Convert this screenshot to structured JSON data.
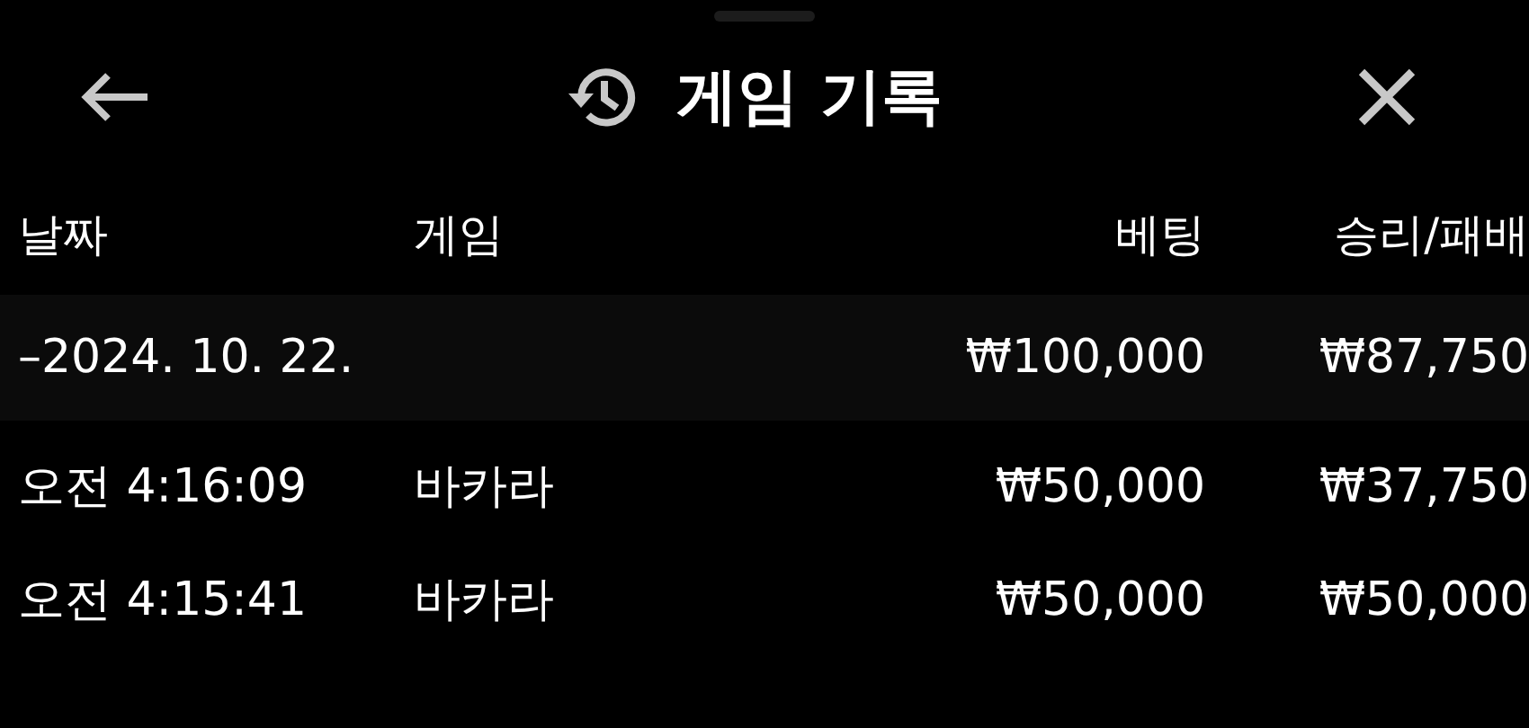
{
  "header": {
    "title": "게임 기록"
  },
  "table": {
    "columns": [
      "날짜",
      "게임",
      "베팅",
      "승리/패배"
    ],
    "groups": [
      {
        "date": "–2024. 10. 22.",
        "bet": "₩100,000",
        "result": "₩87,750",
        "rows": [
          {
            "time": "오전 4:16:09",
            "game": "바카라",
            "bet": "₩50,000",
            "result": "₩37,750"
          },
          {
            "time": "오전 4:15:41",
            "game": "바카라",
            "bet": "₩50,000",
            "result": "₩50,000"
          }
        ]
      }
    ]
  }
}
